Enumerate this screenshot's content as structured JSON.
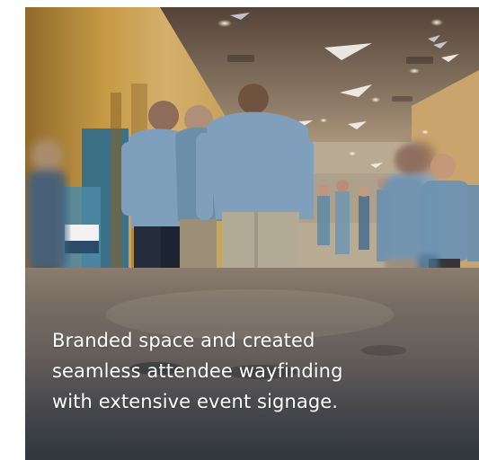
{
  "caption": {
    "line1": "Branded space and created",
    "line2": "seamless attendee wayfinding",
    "line3": "with extensive event signage."
  },
  "colors": {
    "page_background": "#ffffff",
    "caption_text": "#ffffff"
  }
}
